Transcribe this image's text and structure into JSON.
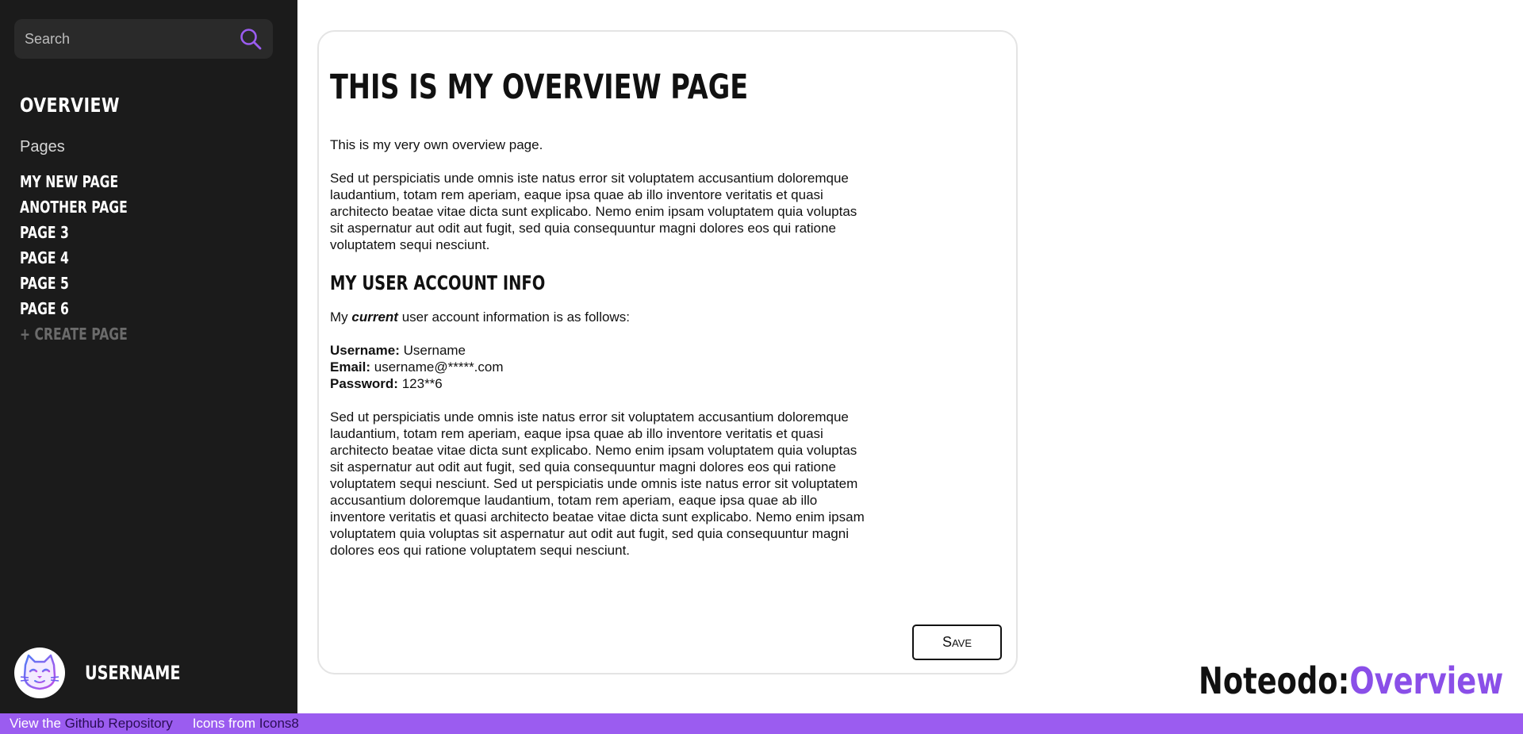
{
  "sidebar": {
    "search": {
      "placeholder": "Search"
    },
    "nav_title": "OVERVIEW",
    "pages_label": "Pages",
    "pages": [
      {
        "label": "MY NEW PAGE"
      },
      {
        "label": "ANOTHER PAGE"
      },
      {
        "label": "PAGE 3"
      },
      {
        "label": "PAGE 4"
      },
      {
        "label": "PAGE 5"
      },
      {
        "label": "PAGE 6"
      }
    ],
    "create_page_label": "+ CREATE PAGE",
    "user": {
      "username": "USERNAME",
      "avatar_icon": "cat-avatar-icon"
    }
  },
  "main": {
    "heading": "THIS IS MY OVERVIEW PAGE",
    "intro": "This is my very own overview page.",
    "lorem_1": "Sed ut perspiciatis unde omnis iste natus error sit voluptatem accusantium doloremque laudantium, totam rem aperiam, eaque ipsa quae ab illo inventore veritatis et quasi architecto beatae vitae dicta sunt explicabo. Nemo enim ipsam voluptatem quia voluptas sit aspernatur aut odit aut fugit, sed quia consequuntur magni dolores eos qui ratione voluptatem sequi nesciunt.",
    "section_heading": "MY USER ACCOUNT INFO",
    "account_intro": {
      "before": "My ",
      "emphasis": "current",
      "after": " user account information is as follows:"
    },
    "account": {
      "username_label": "Username:",
      "username_value": " Username",
      "email_label": "Email:",
      "email_value": " username@*****.com",
      "password_label": "Password:",
      "password_value": " 123**6"
    },
    "lorem_2": "Sed ut perspiciatis unde omnis iste natus error sit voluptatem accusantium doloremque laudantium, totam rem aperiam, eaque ipsa quae ab illo inventore veritatis et quasi architecto beatae vitae dicta sunt explicabo. Nemo enim ipsam voluptatem quia voluptas sit aspernatur aut odit aut fugit, sed quia consequuntur magni dolores eos qui ratione voluptatem sequi nesciunt. Sed ut perspiciatis unde omnis iste natus error sit voluptatem accusantium doloremque laudantium, totam rem aperiam, eaque ipsa quae ab illo inventore veritatis et quasi architecto beatae vitae dicta sunt explicabo. Nemo enim ipsam voluptatem quia voluptas sit aspernatur aut odit aut fugit, sed quia consequuntur magni dolores eos qui ratione voluptatem sequi nesciunt.",
    "save_label": "Save"
  },
  "brand": {
    "name": "Noteodo:",
    "page": "Overview"
  },
  "footer": {
    "repo_prefix": "View the ",
    "repo_link": "Github Repository",
    "icons_prefix": "Icons from ",
    "icons_link": "Icons8"
  },
  "colors": {
    "accent": "#9b5cf0",
    "brand_accent": "#8a4fe8",
    "sidebar_bg": "#1b1b1b",
    "search_bg": "#2a2a2a"
  }
}
